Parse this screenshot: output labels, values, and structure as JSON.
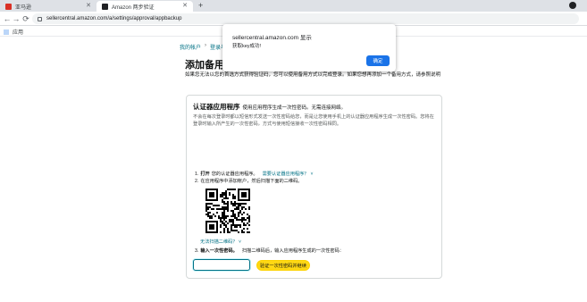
{
  "browser": {
    "tabs": [
      {
        "label": "亚马逊",
        "active": false,
        "favicon_color": "#d93025"
      },
      {
        "label": "Amazon 两步验证",
        "active": true,
        "favicon_color": "#202124"
      }
    ],
    "new_tab_label": "+",
    "close_glyph": "✕",
    "back_glyph": "←",
    "forward_glyph": "→",
    "reload_glyph": "⟳",
    "url": "sellercentral.amazon.com/a/settings/approval/appbackup",
    "bookmarks": {
      "apps_label": "应用"
    }
  },
  "breadcrumb": {
    "items": [
      "我的帐户",
      "登录与安全"
    ],
    "separator": "›"
  },
  "page": {
    "title": "添加备用验证",
    "intro": "如果您无法以您的首选方式获得验证码，您可以使用备用方式以完成登录。如果您想再添加一个备用方式，请参照说明"
  },
  "authenticator": {
    "title": "认证器应用程序",
    "subtitle": "使用应用程序生成一次性密码。无需连接网络。",
    "description": "不会在每次登录时都以短信形式发送一次性密码给您，而是让您使用手机上的认证器应用程序生成一次性密码。您将在登录时输入所产生的一次性密码，方式与使用短信接收一次性密码相同。",
    "step1": {
      "num": "1.",
      "bold": "打开",
      "text": "您的认证器应用程序。",
      "link": "需要认证器应用程序？",
      "chevron": "˅"
    },
    "step2": {
      "num": "2.",
      "text": "在应用程序中添加帐户，然后扫描下面的二维码。"
    },
    "cant_scan_link": "无法扫描二维码？",
    "cant_scan_chevron": "˅",
    "step3": {
      "num": "3.",
      "bold": "输入一次性密码。",
      "text": "扫描二维码后，输入应用程序生成的一次性密码："
    },
    "code_input_value": "",
    "verify_button": "验证一次性密码并继续"
  },
  "alert": {
    "title": "sellercentral.amazon.com 显示",
    "message": "获取key成功!",
    "ok_button": "确定"
  },
  "colors": {
    "link": "#007185",
    "primary_button": "#ffd814",
    "dialog_button": "#1a73e8"
  }
}
